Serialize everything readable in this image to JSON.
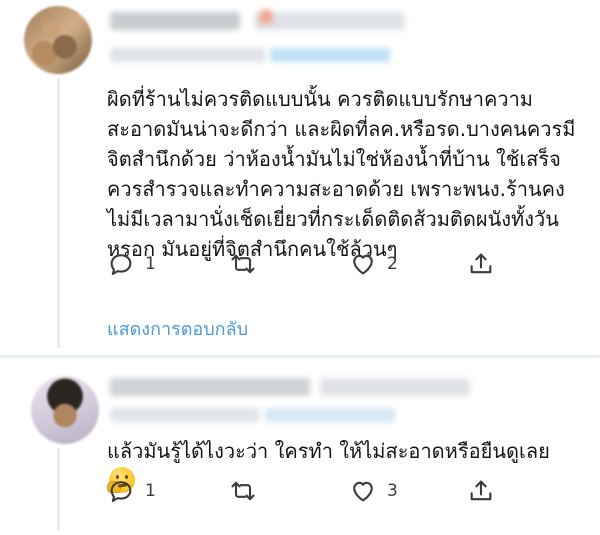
{
  "tweets": [
    {
      "text": "ผิดที่ร้านไม่ควรติดแบบนั้น ควรติดแบบรักษาความสะอาดมันน่าจะดีกว่า และผิดที่ลค.หรือรด.บางคนควรมีจิตสำนึกด้วย ว่าห้องน้ำมันไม่ใช่ห้องน้ำที่บ้าน ใช้เสร็จควรสำรวจและทำความสะอาดด้วย เพราะพนง.ร้านคงไม่มีเวลามานั่งเช็ดเยี่ยวที่กระเด็ดติดส้วมติดผนังทั้งวันหรอก มันอยู่ที่จิตสำนึกคนใช้ล้วนๆ",
      "reply_count": "1",
      "retweet_count": "",
      "like_count": "2",
      "show_replies": "แสดงการตอบกลับ"
    },
    {
      "text": "แล้วมันรู้ได้ไงวะว่า ใครทำ ให้ไม่สะอาดหรือยืนดูเลย",
      "emoji": "thinking-face",
      "reply_count": "1",
      "retweet_count": "",
      "like_count": "3"
    }
  ],
  "colors": {
    "link": "#4a9ad6",
    "icon": "#3b3b3b",
    "divider": "#e8edf0"
  }
}
